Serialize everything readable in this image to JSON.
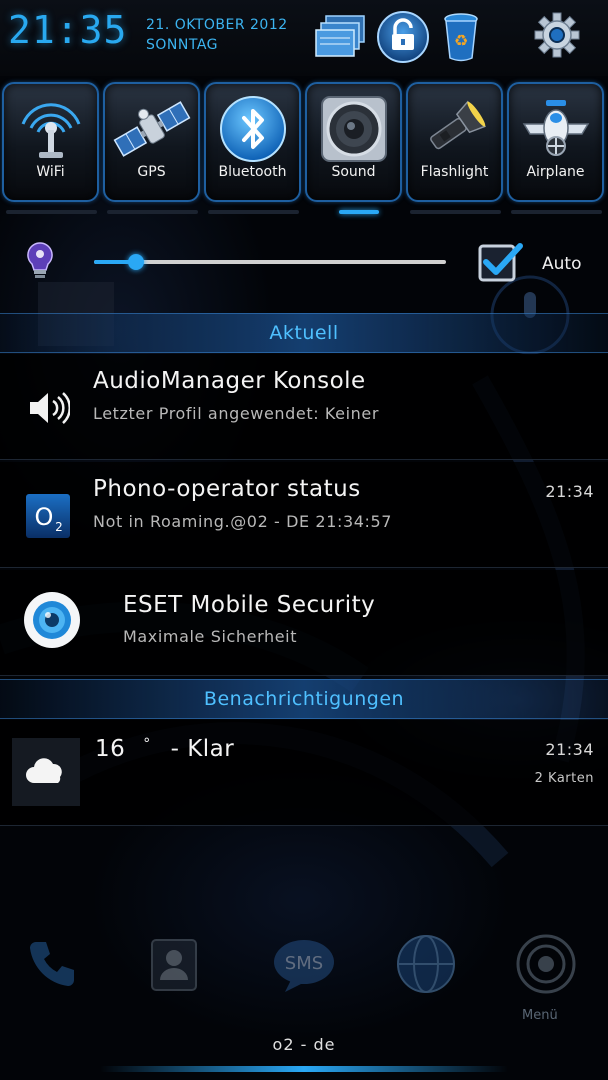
{
  "status_bar": {
    "time": "21:35",
    "date_line1": "21. OKTOBER 2012",
    "date_line2": "SONNTAG",
    "icons": [
      "recent-apps-icon",
      "lock-icon",
      "trash-icon",
      "settings-gear-icon"
    ]
  },
  "toggles": [
    {
      "label": "WiFi",
      "icon": "wifi-antenna-icon"
    },
    {
      "label": "GPS",
      "icon": "gps-satellite-icon"
    },
    {
      "label": "Bluetooth",
      "icon": "bluetooth-icon"
    },
    {
      "label": "Sound",
      "icon": "speaker-icon"
    },
    {
      "label": "Flashlight",
      "icon": "flashlight-icon"
    },
    {
      "label": "Airplane",
      "icon": "airplane-icon"
    }
  ],
  "brightness": {
    "level_percent": 12,
    "auto_checked": true,
    "auto_label": "Auto"
  },
  "sections": {
    "ongoing": "Aktuell",
    "notifications": "Benachrichtigungen"
  },
  "ongoing": [
    {
      "title": "AudioManager Konsole",
      "subtitle": "Letzter Profil angewendet: Keiner",
      "time": "",
      "icon": "volume-icon"
    },
    {
      "title": "Phono-operator status",
      "subtitle": "Not in Roaming.@02 - DE 21:34:57",
      "time": "21:34",
      "icon": "o2-logo-icon"
    },
    {
      "title": "ESET Mobile Security",
      "subtitle": "Maximale Sicherheit",
      "time": "",
      "icon": "eset-eye-icon"
    }
  ],
  "notifications": [
    {
      "title_temp": "16",
      "title_degree": "°",
      "title_rest": "- Klar",
      "time": "21:34",
      "meta": "2 Karten",
      "icon": "cloud-icon"
    }
  ],
  "dock": {
    "menu_label": "Menü",
    "carrier": "o2 - de"
  },
  "colors": {
    "accent": "#2aa8f5",
    "section_text": "#4fc0ff",
    "tile_border": "#1e5fa0"
  }
}
